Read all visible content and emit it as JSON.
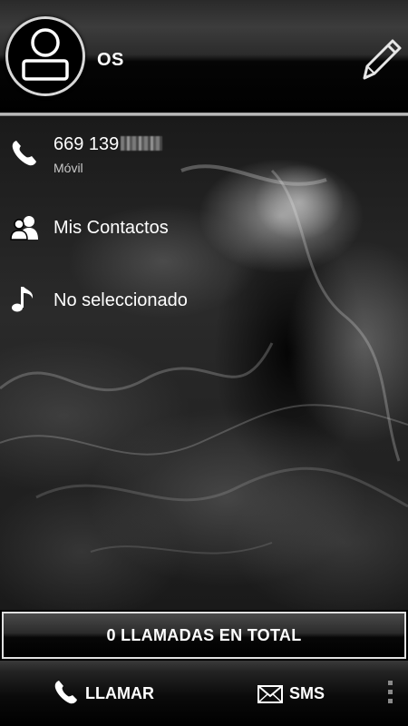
{
  "header": {
    "contact_name": "OS",
    "avatar_icon": "person-icon",
    "edit_icon": "pencil-icon"
  },
  "phone": {
    "number": "669 139",
    "type": "Móvil",
    "icon": "phone-icon"
  },
  "group": {
    "label": "Mis Contactos",
    "icon": "contacts-group-icon"
  },
  "ringtone": {
    "label": "No seleccionado",
    "icon": "music-note-icon"
  },
  "stats": {
    "total_calls_label": "0 LLAMADAS EN TOTAL"
  },
  "actions": {
    "call_label": "LLAMAR",
    "sms_label": "SMS",
    "call_icon": "phone-icon",
    "sms_icon": "envelope-icon",
    "menu_icon": "overflow-menu-icon"
  }
}
